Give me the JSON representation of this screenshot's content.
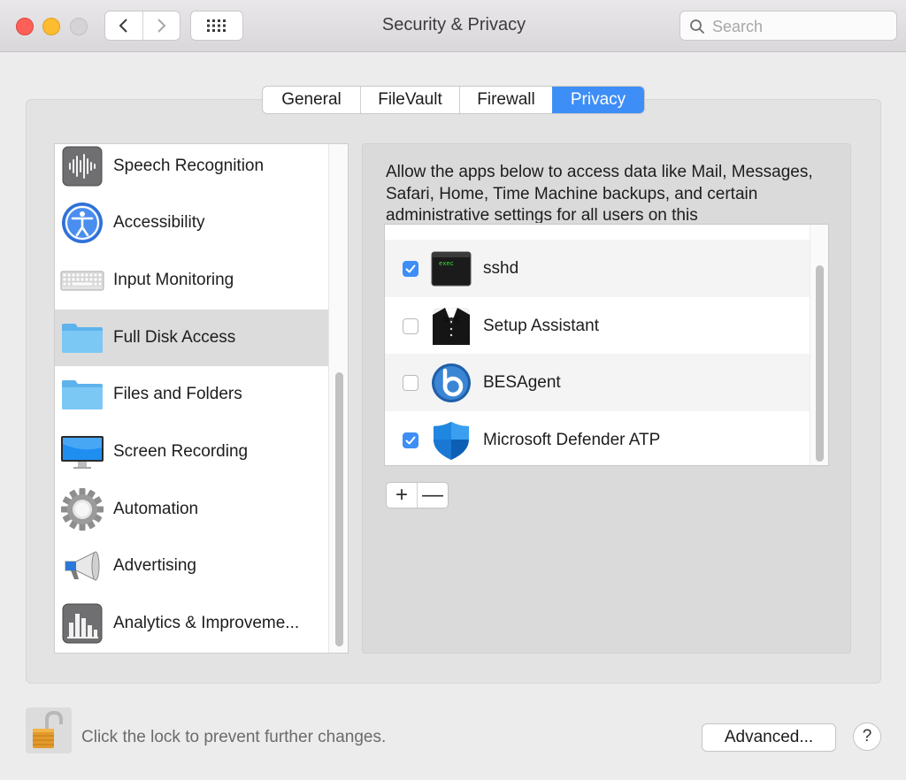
{
  "window": {
    "title": "Security & Privacy",
    "search_placeholder": "Search"
  },
  "tabs": [
    {
      "label": "General",
      "active": false
    },
    {
      "label": "FileVault",
      "active": false
    },
    {
      "label": "Firewall",
      "active": false
    },
    {
      "label": "Privacy",
      "active": true
    }
  ],
  "categories": [
    {
      "label": "Speech Recognition",
      "icon": "speech-waveform-icon"
    },
    {
      "label": "Accessibility",
      "icon": "accessibility-icon"
    },
    {
      "label": "Input Monitoring",
      "icon": "keyboard-icon"
    },
    {
      "label": "Full Disk Access",
      "icon": "folder-icon",
      "selected": true
    },
    {
      "label": "Files and Folders",
      "icon": "folder-icon"
    },
    {
      "label": "Screen Recording",
      "icon": "display-icon"
    },
    {
      "label": "Automation",
      "icon": "gear-icon"
    },
    {
      "label": "Advertising",
      "icon": "megaphone-icon"
    },
    {
      "label": "Analytics & Improveme...",
      "icon": "bar-chart-icon"
    }
  ],
  "detail": {
    "description": "Allow the apps below to access data like Mail, Messages, Safari, Home, Time Machine backups, and certain administrative settings for all users on this",
    "apps": [
      {
        "label": "sshd",
        "checked": true,
        "icon": "terminal-exec-icon"
      },
      {
        "label": "Setup Assistant",
        "checked": false,
        "icon": "setup-assistant-icon"
      },
      {
        "label": "BESAgent",
        "checked": false,
        "icon": "besagent-icon"
      },
      {
        "label": "Microsoft Defender ATP",
        "checked": true,
        "icon": "defender-shield-icon"
      }
    ],
    "add_symbol": "+",
    "remove_symbol": "—",
    "terminal_text": "exec"
  },
  "footer": {
    "lock_text": "Click the lock to prevent further changes.",
    "advanced_label": "Advanced...",
    "help_label": "?"
  },
  "colors": {
    "accent": "#3e8ef7"
  }
}
